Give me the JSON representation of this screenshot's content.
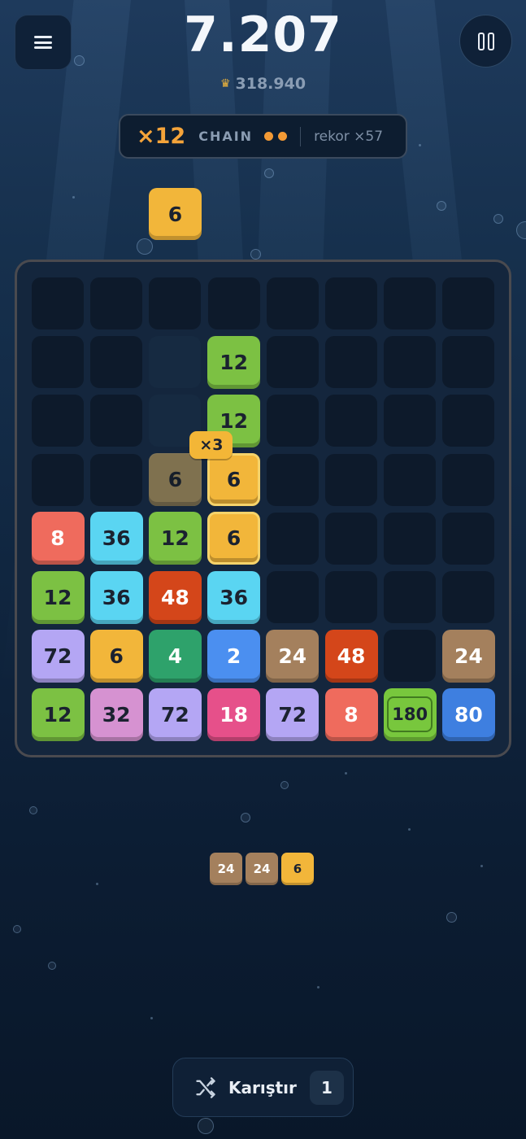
{
  "header": {
    "score": "7.207",
    "best_score": "318.940",
    "menu_icon": "menu-icon",
    "pause_icon": "pause-icon",
    "crown_icon": "crown-icon"
  },
  "chain": {
    "multiplier": "×12",
    "label": "CHAIN",
    "dots": 2,
    "record": "rekor ×57"
  },
  "next_tile": {
    "value": "6",
    "color": "#f2b63a"
  },
  "combo_badge": "×3",
  "board": {
    "cols": 8,
    "rows": 8,
    "tiles": [
      {
        "r": 1,
        "c": 3,
        "v": "12",
        "color": "#7cc143",
        "text": "dark"
      },
      {
        "r": 2,
        "c": 3,
        "v": "12",
        "color": "#7cc143",
        "text": "dark"
      },
      {
        "r": 3,
        "c": 2,
        "v": "6",
        "color": "#f2b63a",
        "text": "dark",
        "state": "ghost"
      },
      {
        "r": 3,
        "c": 3,
        "v": "6",
        "color": "#f2b63a",
        "text": "dark",
        "state": "selected"
      },
      {
        "r": 4,
        "c": 0,
        "v": "8",
        "color": "#ef6b5d",
        "text": "light"
      },
      {
        "r": 4,
        "c": 1,
        "v": "36",
        "color": "#5ad5f2",
        "text": "dark"
      },
      {
        "r": 4,
        "c": 2,
        "v": "12",
        "color": "#7cc143",
        "text": "dark"
      },
      {
        "r": 4,
        "c": 3,
        "v": "6",
        "color": "#f2b63a",
        "text": "dark",
        "state": "selected"
      },
      {
        "r": 5,
        "c": 0,
        "v": "12",
        "color": "#7cc143",
        "text": "dark"
      },
      {
        "r": 5,
        "c": 1,
        "v": "36",
        "color": "#5ad5f2",
        "text": "dark"
      },
      {
        "r": 5,
        "c": 2,
        "v": "48",
        "color": "#d4461a",
        "text": "light"
      },
      {
        "r": 5,
        "c": 3,
        "v": "36",
        "color": "#5ad5f2",
        "text": "dark"
      },
      {
        "r": 6,
        "c": 0,
        "v": "72",
        "color": "#b4a6f4",
        "text": "dark"
      },
      {
        "r": 6,
        "c": 1,
        "v": "6",
        "color": "#f2b63a",
        "text": "dark"
      },
      {
        "r": 6,
        "c": 2,
        "v": "4",
        "color": "#2ea26b",
        "text": "light"
      },
      {
        "r": 6,
        "c": 3,
        "v": "2",
        "color": "#4b8ff0",
        "text": "light"
      },
      {
        "r": 6,
        "c": 4,
        "v": "24",
        "color": "#a4805d",
        "text": "light"
      },
      {
        "r": 6,
        "c": 5,
        "v": "48",
        "color": "#d4461a",
        "text": "light"
      },
      {
        "r": 6,
        "c": 7,
        "v": "24",
        "color": "#a4805d",
        "text": "light"
      },
      {
        "r": 7,
        "c": 0,
        "v": "12",
        "color": "#7cc143",
        "text": "dark"
      },
      {
        "r": 7,
        "c": 1,
        "v": "32",
        "color": "#d692d1",
        "text": "dark"
      },
      {
        "r": 7,
        "c": 2,
        "v": "72",
        "color": "#b4a6f4",
        "text": "dark"
      },
      {
        "r": 7,
        "c": 3,
        "v": "18",
        "color": "#e6508a",
        "text": "light"
      },
      {
        "r": 7,
        "c": 4,
        "v": "72",
        "color": "#b4a6f4",
        "text": "dark"
      },
      {
        "r": 7,
        "c": 5,
        "v": "8",
        "color": "#ef6b5d",
        "text": "light"
      },
      {
        "r": 7,
        "c": 6,
        "v": "180",
        "color": "#78c73d",
        "text": "dark",
        "state": "boxed"
      },
      {
        "r": 7,
        "c": 7,
        "v": "80",
        "color": "#3e7fe0",
        "text": "light"
      }
    ],
    "lit_cells": [
      {
        "r": 1,
        "c": 2
      },
      {
        "r": 2,
        "c": 2
      }
    ]
  },
  "queue": [
    {
      "v": "24",
      "color": "#a4805d",
      "text": "light"
    },
    {
      "v": "24",
      "color": "#a4805d",
      "text": "light"
    },
    {
      "v": "6",
      "color": "#f2b63a",
      "text": "dark"
    }
  ],
  "shuffle": {
    "label": "Karıştır",
    "count": "1",
    "icon": "shuffle-icon"
  }
}
